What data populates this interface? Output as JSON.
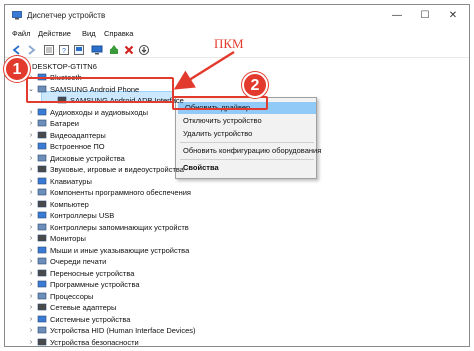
{
  "window": {
    "title": "Диспетчер устройств",
    "minimize": "—",
    "maximize": "☐",
    "close": "✕"
  },
  "menu": [
    "Файл",
    "Действие",
    "Вид",
    "Справка"
  ],
  "toolbar_icons": [
    "back-icon",
    "forward-icon",
    "properties-icon",
    "help-icon",
    "scan-icon",
    "monitor-icon",
    "update-driver-icon",
    "remove-icon",
    "download-icon"
  ],
  "tree": {
    "root": "DESKTOP-GTITN6",
    "items": [
      {
        "label": "Bluetooth",
        "icon": "bluetooth-icon",
        "expanded": false
      },
      {
        "label": "SAMSUNG Android Phone",
        "icon": "phone-icon",
        "expanded": true
      },
      {
        "label": "SAMSUNG Android ADB Interface",
        "icon": "usb-device-icon",
        "child": true
      },
      {
        "label": "Аудиовходы и аудиовыходы",
        "icon": "audio-icon",
        "expanded": false
      },
      {
        "label": "Батареи",
        "icon": "battery-icon",
        "expanded": false
      },
      {
        "label": "Видеоадаптеры",
        "icon": "display-adapter-icon",
        "expanded": false
      },
      {
        "label": "Встроенное ПО",
        "icon": "firmware-icon",
        "expanded": false
      },
      {
        "label": "Дисковые устройства",
        "icon": "disk-icon",
        "expanded": false
      },
      {
        "label": "Звуковые, игровые и видеоустройства",
        "icon": "sound-icon",
        "expanded": false
      },
      {
        "label": "Клавиатуры",
        "icon": "keyboard-icon",
        "expanded": false
      },
      {
        "label": "Компоненты программного обеспечения",
        "icon": "software-component-icon",
        "expanded": false
      },
      {
        "label": "Компьютер",
        "icon": "computer-icon",
        "expanded": false
      },
      {
        "label": "Контроллеры USB",
        "icon": "usb-controller-icon",
        "expanded": false
      },
      {
        "label": "Контроллеры запоминающих устройств",
        "icon": "storage-controller-icon",
        "expanded": false
      },
      {
        "label": "Мониторы",
        "icon": "monitor-icon",
        "expanded": false
      },
      {
        "label": "Мыши и иные указывающие устройства",
        "icon": "mouse-icon",
        "expanded": false
      },
      {
        "label": "Очереди печати",
        "icon": "printer-icon",
        "expanded": false
      },
      {
        "label": "Переносные устройства",
        "icon": "portable-device-icon",
        "expanded": false
      },
      {
        "label": "Программные устройства",
        "icon": "software-device-icon",
        "expanded": false
      },
      {
        "label": "Процессоры",
        "icon": "cpu-icon",
        "expanded": false
      },
      {
        "label": "Сетевые адаптеры",
        "icon": "network-icon",
        "expanded": false
      },
      {
        "label": "Системные устройства",
        "icon": "system-device-icon",
        "expanded": false
      },
      {
        "label": "Устройства HID (Human Interface Devices)",
        "icon": "hid-icon",
        "expanded": false
      },
      {
        "label": "Устройства безопасности",
        "icon": "security-icon",
        "expanded": false
      }
    ]
  },
  "context_menu": {
    "items": [
      {
        "label": "Обновить драйвер",
        "highlighted": true,
        "bold": false
      },
      {
        "label": "Отключить устройство",
        "highlighted": false,
        "bold": false
      },
      {
        "label": "Удалить устройство",
        "highlighted": false,
        "bold": false
      },
      {
        "separator": true
      },
      {
        "label": "Обновить конфигурацию оборудования",
        "highlighted": false,
        "bold": false
      },
      {
        "separator": true
      },
      {
        "label": "Свойства",
        "highlighted": false,
        "bold": true
      }
    ]
  },
  "annotations": {
    "step1": "1",
    "step2": "2",
    "right_click_label": "ПКМ"
  },
  "colors": {
    "accent_red": "#e23b2e",
    "selection_bg": "#cce8ff",
    "menu_highlight": "#91c9f7"
  }
}
